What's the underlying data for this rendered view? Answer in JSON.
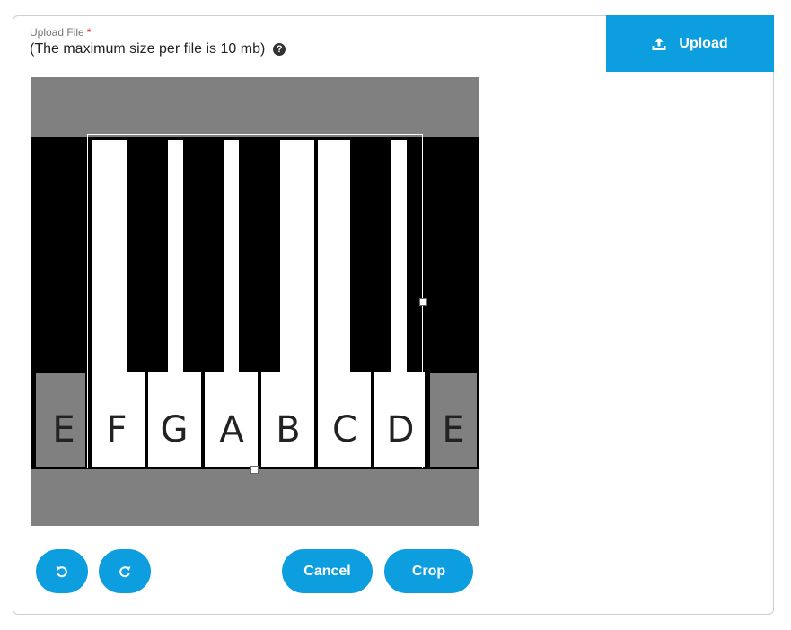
{
  "form": {
    "label": "Upload File",
    "required_mark": "*",
    "hint": "(The maximum size per file is 10 mb)",
    "help_glyph": "?"
  },
  "upload_button": {
    "label": "Upload",
    "icon": "upload-icon"
  },
  "image": {
    "white_keys": [
      "E",
      "F",
      "G",
      "A",
      "B",
      "C",
      "D",
      "E"
    ]
  },
  "actions": {
    "rotate_left_icon": "rotate-left-icon",
    "rotate_right_icon": "rotate-right-icon",
    "cancel_label": "Cancel",
    "crop_label": "Crop"
  },
  "colors": {
    "accent": "#0d9ee0",
    "required": "#e0231b",
    "image_background": "#808080"
  }
}
